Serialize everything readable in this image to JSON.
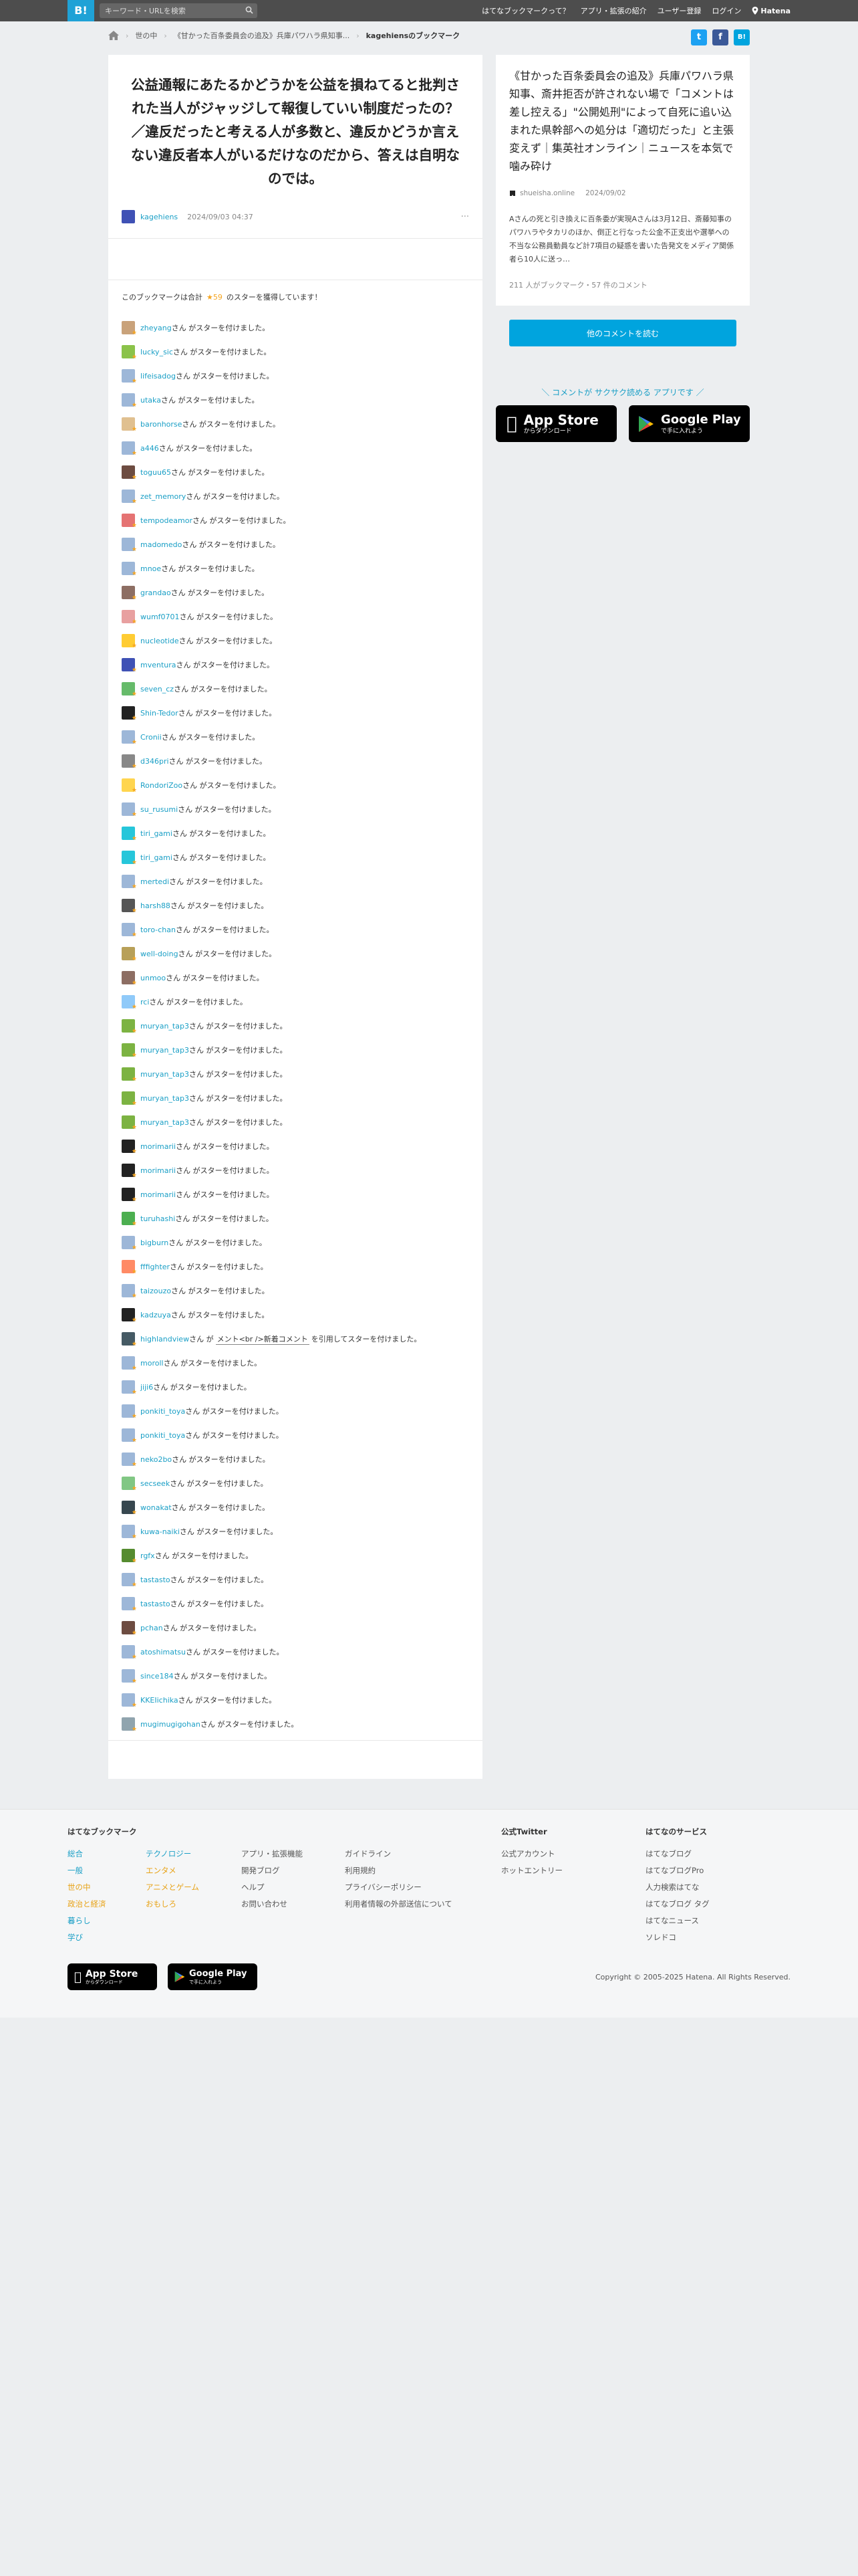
{
  "header": {
    "logo": "B!",
    "search_placeholder": "キーワード・URLを検索",
    "nav": [
      "はてなブックマークって？",
      "アプリ・拡張の紹介",
      "ユーザー登録",
      "ログイン"
    ],
    "hatena_logo": "Hatena"
  },
  "breadcrumb": [
    "世の中",
    "《甘かった百条委員会の追及》兵庫パワハラ県知事...",
    "kagehiensのブックマーク"
  ],
  "social": {
    "twitter": "t",
    "facebook": "f",
    "hatebu": "B!"
  },
  "bookmark": {
    "comment": "公益通報にあたるかどうかを公益を損ねてると批判された当人がジャッジして報復していい制度だったの？／違反だったと考える人が多数と、違反かどうか言えない違反者本人がいるだけなのだから、答えは自明なのでは。",
    "user": "kagehiens",
    "date": "2024/09/03 04:37",
    "more": "···"
  },
  "summary": {
    "prefix": "このブックマークは合計",
    "stars": "★59",
    "suffix": "のスターを獲得しています！"
  },
  "star_suffix": "さん がスターを付けました。",
  "quote_mid": "さん が",
  "quote_text": "メント<br />新着コメント",
  "quote_suffix": "を引用してスターを付けました。",
  "stars": [
    {
      "user": "zheyang",
      "color": "#c9a27a"
    },
    {
      "user": "lucky_sic",
      "color": "#8bc34a"
    },
    {
      "user": "lifeisadog",
      "color": "#9db7d8"
    },
    {
      "user": "utaka",
      "color": "#9db7d8"
    },
    {
      "user": "baronhorse",
      "color": "#e0c090"
    },
    {
      "user": "a446",
      "color": "#9db7d8"
    },
    {
      "user": "toguu65",
      "color": "#6d4c41"
    },
    {
      "user": "zet_memory",
      "color": "#9db7d8"
    },
    {
      "user": "tempodeamor",
      "color": "#e57373"
    },
    {
      "user": "madomedo",
      "color": "#9db7d8"
    },
    {
      "user": "mnoe",
      "color": "#9db7d8"
    },
    {
      "user": "grandao",
      "color": "#8d6e63"
    },
    {
      "user": "wumf0701",
      "color": "#e8a0a0"
    },
    {
      "user": "nucleotide",
      "color": "#ffcc33"
    },
    {
      "user": "mventura",
      "color": "#3f51b5"
    },
    {
      "user": "seven_cz",
      "color": "#66bb6a"
    },
    {
      "user": "Shin-Tedor",
      "color": "#222222"
    },
    {
      "user": "Cronii",
      "color": "#9db7d8"
    },
    {
      "user": "d346pri",
      "color": "#888888"
    },
    {
      "user": "RondoriZoo",
      "color": "#ffd54f"
    },
    {
      "user": "su_rusumi",
      "color": "#9db7d8"
    },
    {
      "user": "tiri_gami",
      "color": "#26c6da"
    },
    {
      "user": "tiri_gami",
      "color": "#26c6da"
    },
    {
      "user": "mertedi",
      "color": "#9db7d8"
    },
    {
      "user": "harsh88",
      "color": "#555555"
    },
    {
      "user": "toro-chan",
      "color": "#9db7d8"
    },
    {
      "user": "well-doing",
      "color": "#b8a058"
    },
    {
      "user": "unmoo",
      "color": "#8d6e63"
    },
    {
      "user": "rci",
      "color": "#90caf9"
    },
    {
      "user": "muryan_tap3",
      "color": "#7cb342"
    },
    {
      "user": "muryan_tap3",
      "color": "#7cb342"
    },
    {
      "user": "muryan_tap3",
      "color": "#7cb342"
    },
    {
      "user": "muryan_tap3",
      "color": "#7cb342"
    },
    {
      "user": "muryan_tap3",
      "color": "#7cb342"
    },
    {
      "user": "morimarii",
      "color": "#222222"
    },
    {
      "user": "morimarii",
      "color": "#222222"
    },
    {
      "user": "morimarii",
      "color": "#222222"
    },
    {
      "user": "turuhashi",
      "color": "#4caf50"
    },
    {
      "user": "bigburn",
      "color": "#9db7d8"
    },
    {
      "user": "fffighter",
      "color": "#ff8a65"
    },
    {
      "user": "taizouzo",
      "color": "#9db7d8"
    },
    {
      "user": "kadzuya",
      "color": "#222222"
    },
    {
      "user": "highlandview",
      "color": "#455a64",
      "quote": true
    },
    {
      "user": "moroll",
      "color": "#9db7d8"
    },
    {
      "user": "jiji6",
      "color": "#9db7d8"
    },
    {
      "user": "ponkiti_toya",
      "color": "#9db7d8"
    },
    {
      "user": "ponkiti_toya",
      "color": "#9db7d8"
    },
    {
      "user": "neko2bo",
      "color": "#9db7d8"
    },
    {
      "user": "secseek",
      "color": "#81c784"
    },
    {
      "user": "wonakat",
      "color": "#37474f"
    },
    {
      "user": "kuwa-naiki",
      "color": "#9db7d8"
    },
    {
      "user": "rgfx",
      "color": "#558b2f"
    },
    {
      "user": "tastasto",
      "color": "#9db7d8"
    },
    {
      "user": "tastasto",
      "color": "#9db7d8"
    },
    {
      "user": "pchan",
      "color": "#6d4c41"
    },
    {
      "user": "atoshimatsu",
      "color": "#9db7d8"
    },
    {
      "user": "since184",
      "color": "#9db7d8"
    },
    {
      "user": "KKEIichika",
      "color": "#9db7d8"
    },
    {
      "user": "mugimugigohan",
      "color": "#90a4ae"
    }
  ],
  "entry": {
    "title": "《甘かった百条委員会の追及》兵庫パワハラ県知事、斎井拒否が許されない場で「コメントは差し控える」\"公開処刑\"によって自死に追い込まれた県幹部への処分は「適切だった」と主張変えず｜集英社オンライン｜ニュースを本気で噛み砕け",
    "source": "shueisha.online",
    "date": "2024/09/02",
    "description": "Aさんの死と引き換えに百条委が実現Aさんは3月12日、斎藤知事のパワハラやタカリのほか、倒正と行なった公金不正支出や選挙への不当な公務員動員など計7項目の疑惑を書いた告発文をメディア関係者ら10人に送っ…",
    "counts": "211 人がブックマーク・57 件のコメント",
    "more_button": "他のコメントを読む"
  },
  "promo": {
    "text": "＼ コメントが サクサク読める アプリです ／",
    "appstore_top": "App Store",
    "appstore_bottom": "からダウンロード",
    "googleplay_top": "Google Play",
    "googleplay_bottom": "で手に入れよう"
  },
  "footer": {
    "col1_title": "はてなブックマーク",
    "col1": [
      "総合",
      "一般",
      "世の中",
      "政治と経済",
      "暮らし",
      "学び"
    ],
    "col2": [
      "テクノロジー",
      "エンタメ",
      "アニメとゲーム",
      "おもしろ"
    ],
    "col3": [
      "アプリ・拡張機能",
      "開発ブログ",
      "ヘルプ",
      "お問い合わせ"
    ],
    "col4": [
      "ガイドライン",
      "利用規約",
      "プライバシーポリシー",
      "利用者情報の外部送信について"
    ],
    "twitter_title": "公式Twitter",
    "twitter": [
      "公式アカウント",
      "ホットエントリー"
    ],
    "services_title": "はてなのサービス",
    "services": [
      "はてなブログ",
      "はてなブログPro",
      "人力検索はてな",
      "はてなブログ タグ",
      "はてなニュース",
      "ソレドコ"
    ],
    "appstore_top": "App Store",
    "appstore_bottom": "からダウンロード",
    "googleplay_top": "Google Play",
    "googleplay_bottom": "で手に入れよう",
    "copyright": "Copyright © 2005-2025 Hatena. All Rights Reserved."
  }
}
